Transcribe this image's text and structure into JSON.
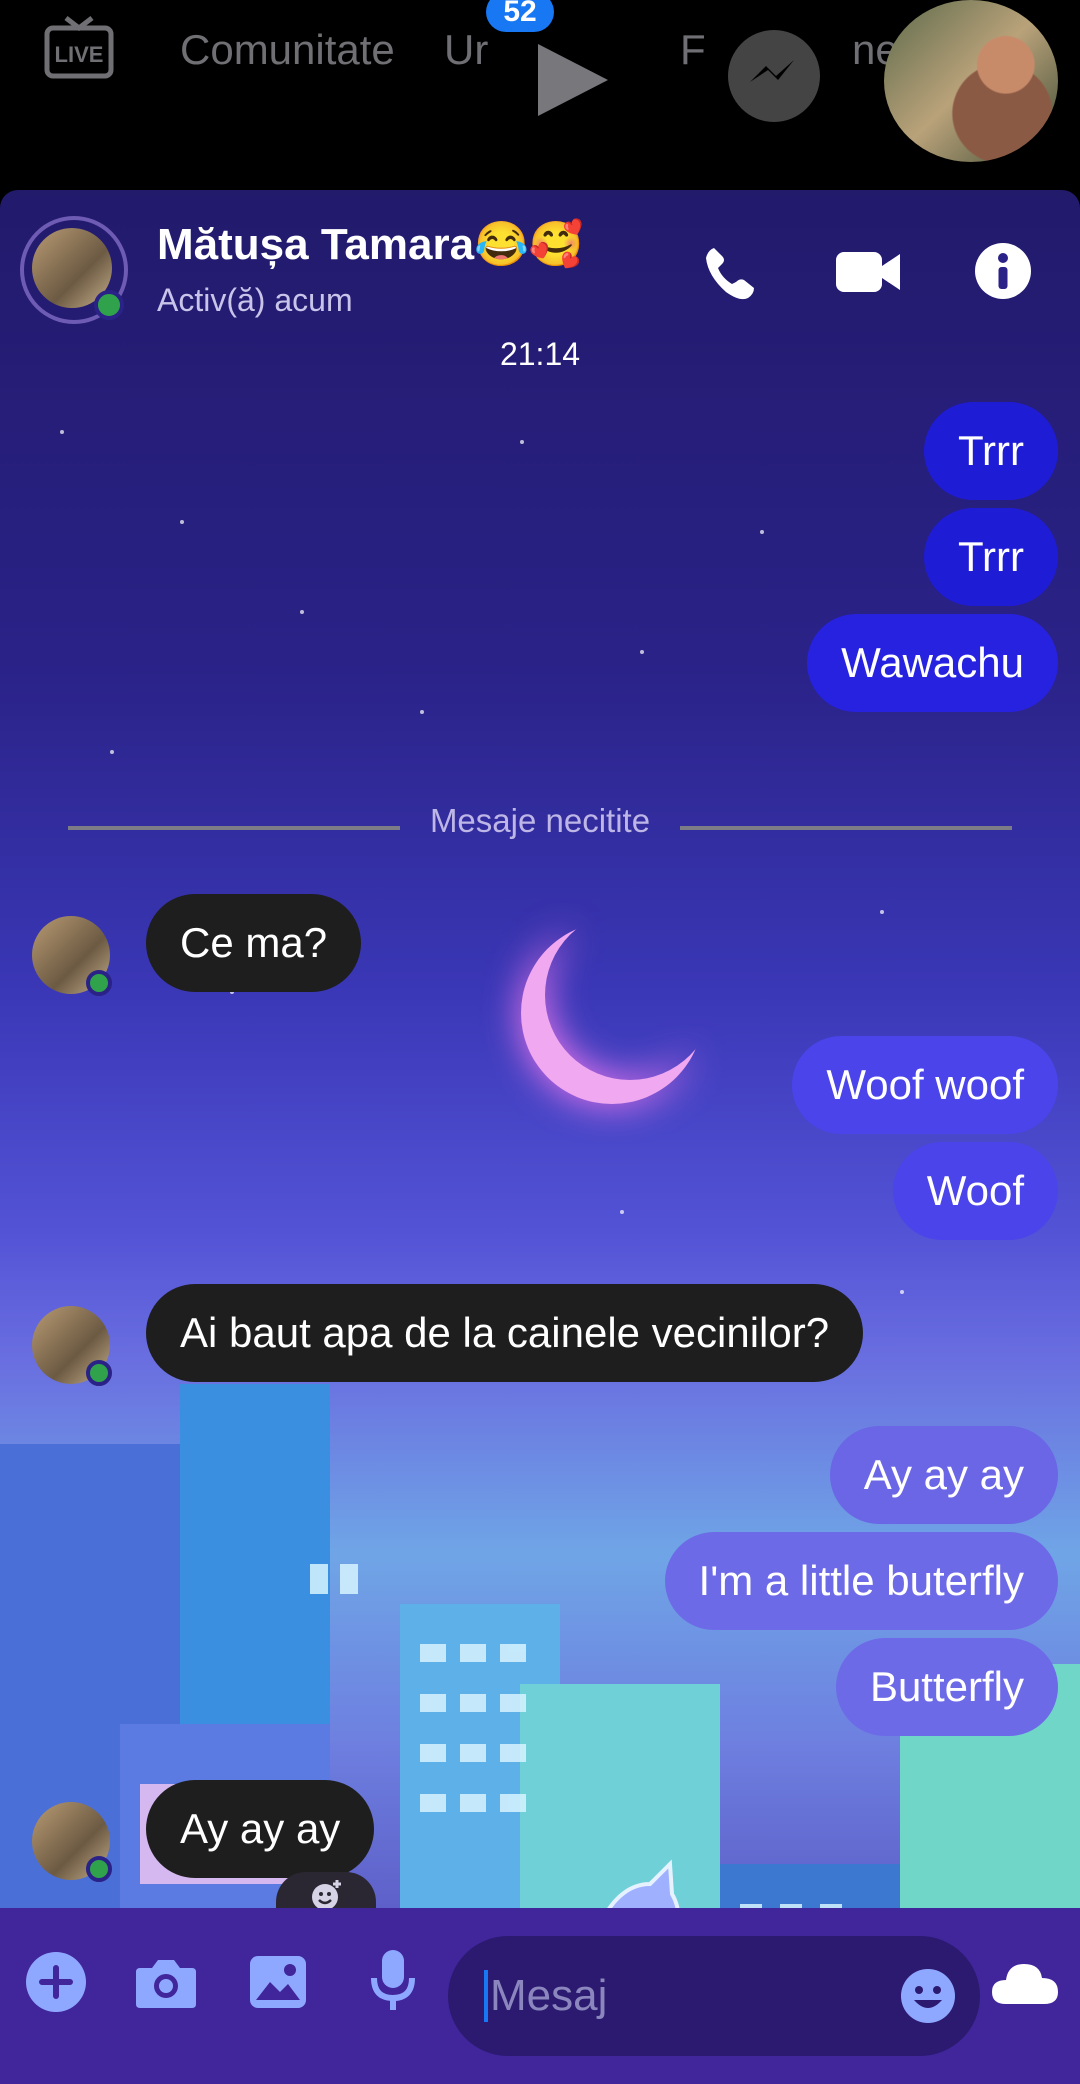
{
  "topbar": {
    "tab_comunitate": "Comunitate",
    "tab_ur": "Ur",
    "tab_partial_f": "F",
    "tab_partial_ne": "ne",
    "badge_count": "52"
  },
  "header": {
    "contact_name": "Mătușa Tamara😂🥰",
    "status": "Activ(ă) acum"
  },
  "conversation": {
    "timestamp": "21:14",
    "unread_label": "Mesaje necitite",
    "messages": [
      {
        "sender": "me",
        "text": "Trrr"
      },
      {
        "sender": "me",
        "text": "Trrr"
      },
      {
        "sender": "me",
        "text": "Wawachu"
      },
      {
        "sender": "them",
        "text": "Ce ma?"
      },
      {
        "sender": "me",
        "text": "Woof woof"
      },
      {
        "sender": "me",
        "text": "Woof"
      },
      {
        "sender": "them",
        "text": "Ai baut apa de la cainele vecinilor?"
      },
      {
        "sender": "me",
        "text": "Ay ay ay"
      },
      {
        "sender": "me",
        "text": "I'm a little buterfly"
      },
      {
        "sender": "me",
        "text": "Butterfly"
      },
      {
        "sender": "them",
        "text": "Ay ay ay"
      }
    ]
  },
  "composer": {
    "placeholder": "Mesaj"
  },
  "colors": {
    "bubble_out_dark": "#1f1cd6",
    "bubble_out_mid": "#4a44ea",
    "bubble_out_light": "#6d6ae8",
    "bubble_in": "#1e1e1e",
    "online": "#31a24c",
    "accent": "#1877f2"
  },
  "icons": [
    "live-icon",
    "play-icon",
    "messenger-icon",
    "phone-icon",
    "video-icon",
    "info-icon",
    "plus-icon",
    "camera-icon",
    "gallery-icon",
    "mic-icon",
    "emoji-icon",
    "cloud-icon",
    "add-reaction-icon"
  ]
}
